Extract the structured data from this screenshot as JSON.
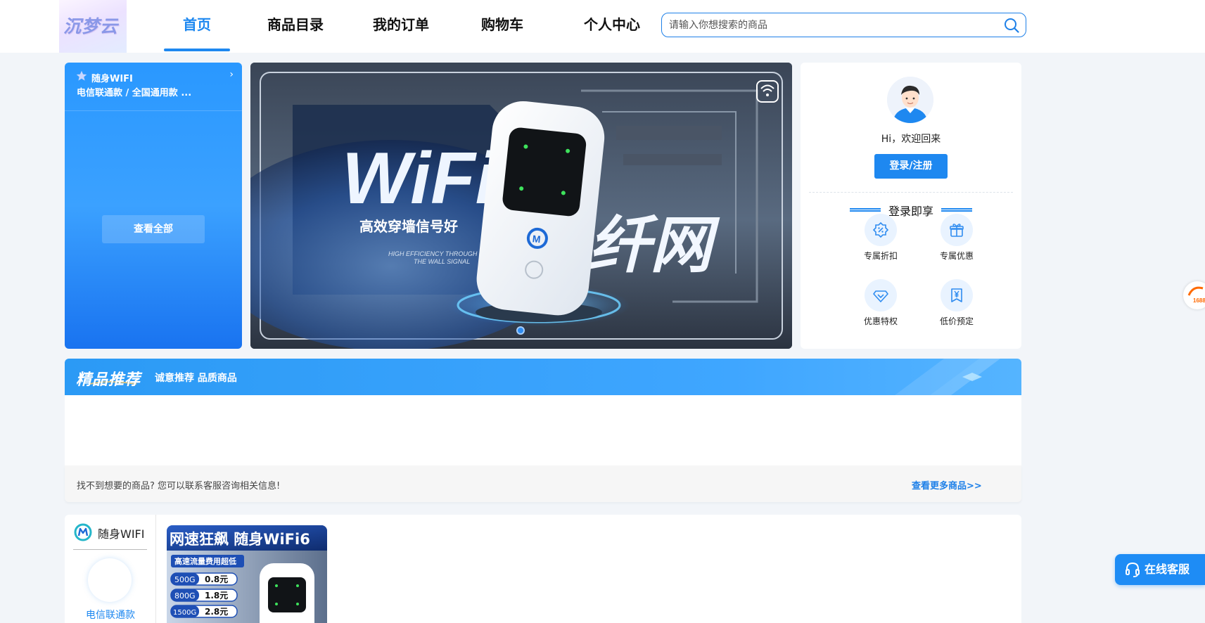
{
  "header": {
    "logo_text": "沉梦云",
    "nav": [
      "首页",
      "商品目录",
      "我的订单",
      "购物车",
      "个人中心"
    ],
    "active_nav": "首页",
    "search_placeholder": "请输入你想搜索的商品"
  },
  "side_menu": {
    "category_title": "随身WIFI",
    "category_sub": "电信联通款 / 全国通用款 ...",
    "view_all": "查看全部"
  },
  "banner": {
    "headline": "WiFi6",
    "tagline": "高效穿墙信号好",
    "tagline_en_1": "HIGH EFFICIENCY THROUGH",
    "tagline_en_2": "THE WALL SIGNAL",
    "big_text": "纤网",
    "active_slide": 1
  },
  "user_card": {
    "welcome": "Hi，欢迎回来",
    "login_button": "登录/注册",
    "perks_title": "登录即享",
    "perks": [
      {
        "label": "专属折扣",
        "icon": "discount-icon"
      },
      {
        "label": "专属优惠",
        "icon": "gift-icon"
      },
      {
        "label": "优惠特权",
        "icon": "diamond-icon"
      },
      {
        "label": "低价预定",
        "icon": "yen-icon"
      }
    ]
  },
  "recommend": {
    "title": "精品推荐",
    "subtitle": "诚意推荐 品质商品",
    "footer_text": "找不到想要的商品? 您可以联系客服咨询相关信息!",
    "more_link": "查看更多商品>>"
  },
  "category_panel": {
    "name": "随身WIFI",
    "sub": "电信联通款",
    "product": {
      "headline": "网速狂飙 随身WiFi6",
      "sub": "高速流量费用超低",
      "prices": [
        {
          "size": "500G",
          "price": "0.8元"
        },
        {
          "size": "800G",
          "price": "1.8元"
        },
        {
          "size": "1500G",
          "price": "2.8元"
        }
      ]
    }
  },
  "float_badge": "1688",
  "service_button": "在线客服",
  "colors": {
    "accent": "#1e88f0",
    "background": "#f2f5f9"
  }
}
